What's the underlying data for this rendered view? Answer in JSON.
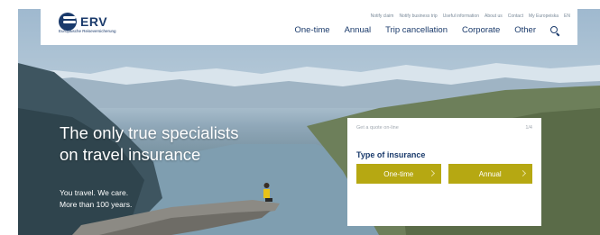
{
  "brand": {
    "name": "ERV",
    "subtitle": "Europäische Reiseversicherung",
    "color": "#1a3a6b"
  },
  "top_links": [
    "Notify claim",
    "Notify business trip",
    "Useful information",
    "About us",
    "Contact",
    "My Europeiska",
    "EN"
  ],
  "main_nav": [
    "One-time",
    "Annual",
    "Trip cancellation",
    "Corporate",
    "Other"
  ],
  "icons": {
    "search": "search-icon",
    "logo": "erv-logo-icon",
    "chevron": "chevron-right-icon"
  },
  "hero": {
    "headline_line1": "The only true specialists",
    "headline_line2": "on travel insurance",
    "tagline_line1": "You travel. We care.",
    "tagline_line2": "More than 100 years."
  },
  "quote": {
    "title": "Get a quote on-line",
    "step": "1/4",
    "type_label": "Type of insurance",
    "buttons": [
      "One-time",
      "Annual"
    ],
    "button_color": "#b6a812"
  }
}
